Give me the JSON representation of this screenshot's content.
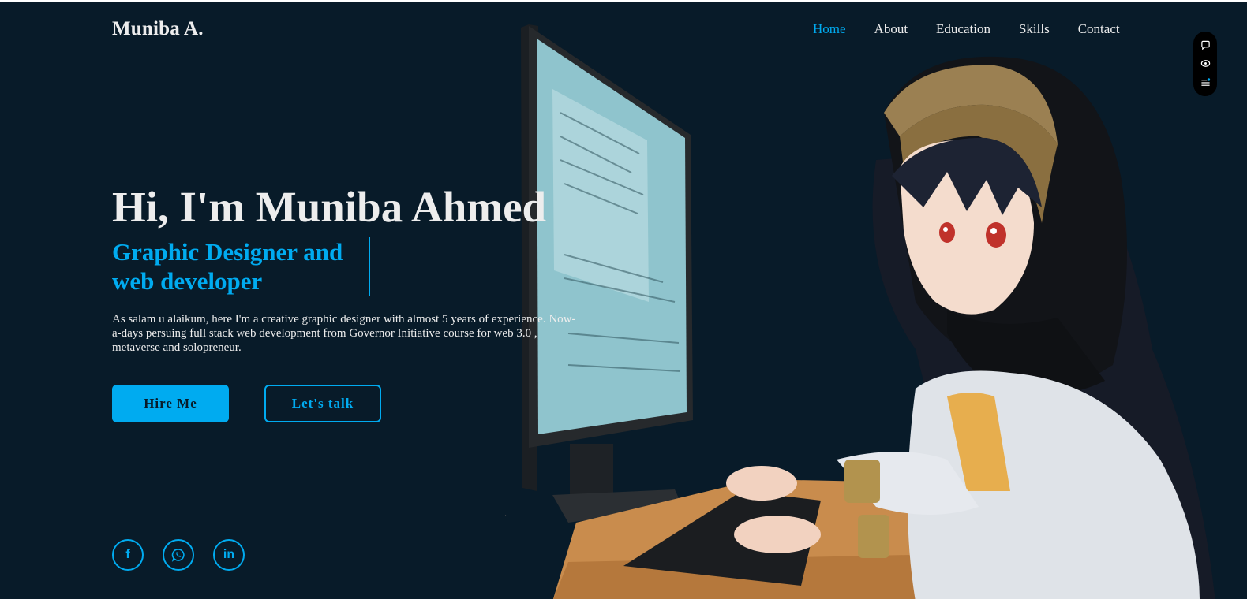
{
  "header": {
    "logo": "Muniba A.",
    "nav": [
      {
        "label": "Home",
        "active": true
      },
      {
        "label": "About",
        "active": false
      },
      {
        "label": "Education",
        "active": false
      },
      {
        "label": "Skills",
        "active": false
      },
      {
        "label": "Contact",
        "active": false
      }
    ]
  },
  "hero": {
    "title": "Hi, I'm Muniba Ahmed",
    "subtitle_line1": "Graphic Designer and",
    "subtitle_line2": "web developer",
    "description": "As salam u alaikum, here I'm a creative graphic designer with almost 5 years of experience. Now-a-days persuing full stack web development from Governor Initiative course for web 3.0 , metaverse and solopreneur.",
    "primary_button": "Hire Me",
    "secondary_button": "Let's talk"
  },
  "social": {
    "facebook_glyph": "f",
    "linkedin_glyph": "in"
  },
  "floating_toolbar": {
    "icons": [
      "chat-bubble-icon",
      "eye-icon",
      "list-settings-icon"
    ]
  },
  "colors": {
    "background": "#081b29",
    "accent": "#00abf0",
    "text": "#ededed"
  }
}
